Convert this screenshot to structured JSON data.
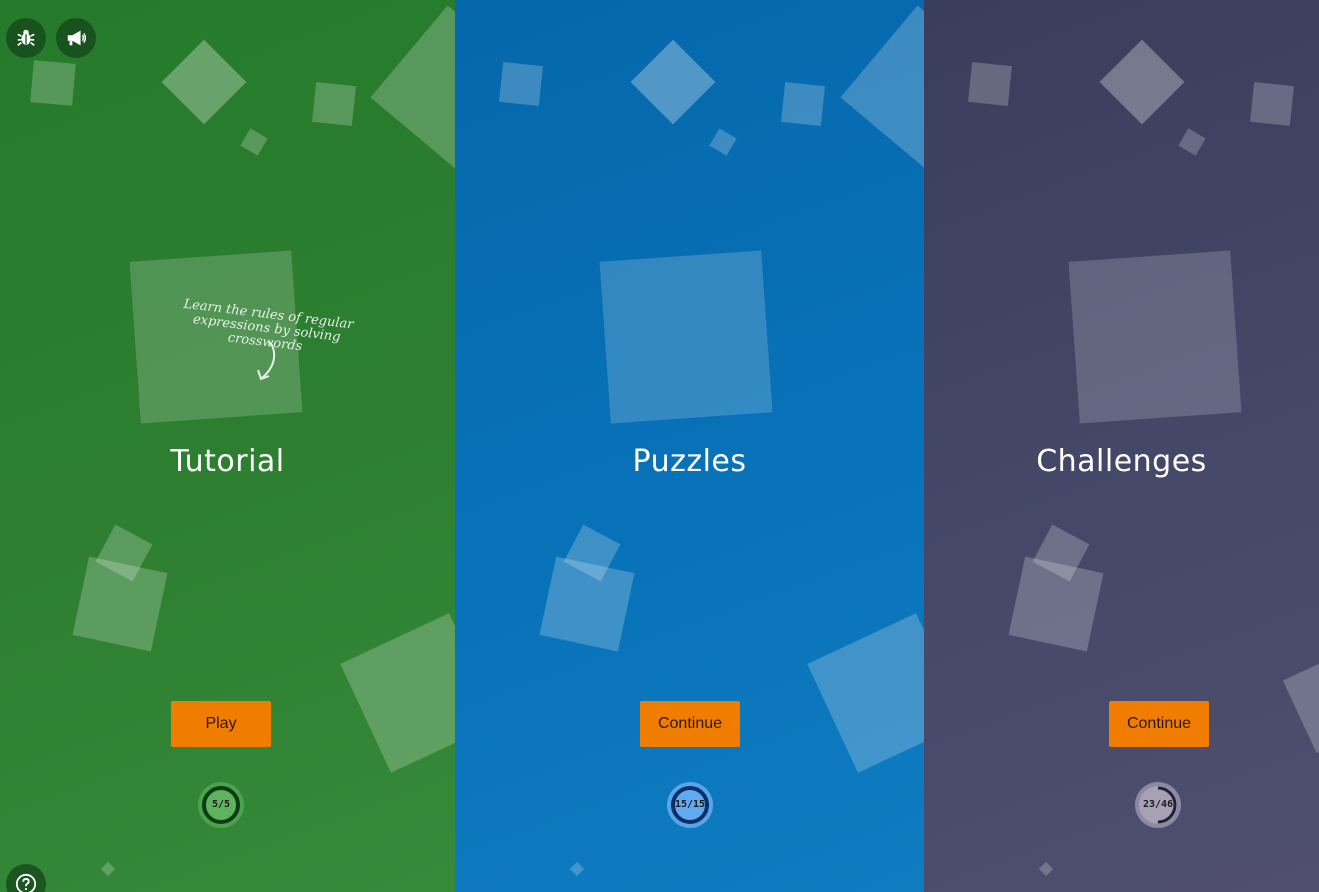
{
  "panels": {
    "tutorial": {
      "title": "Tutorial",
      "button_label": "Play",
      "progress_label": "5/5",
      "progress_fraction": 1.0,
      "hint": "Learn the rules of regular expressions by solving crosswords"
    },
    "puzzles": {
      "title": "Puzzles",
      "button_label": "Continue",
      "progress_label": "15/15",
      "progress_fraction": 1.0
    },
    "challenges": {
      "title": "Challenges",
      "button_label": "Continue",
      "progress_label": "23/46",
      "progress_fraction": 0.5
    }
  },
  "toolbar": {
    "icons": [
      "bug-icon",
      "megaphone-icon",
      "help-icon"
    ]
  },
  "colors": {
    "tutorial_bg": "#2e7f31",
    "puzzles_bg": "#0872b8",
    "challenges_bg": "#454868",
    "button_accent": "#f07c00"
  }
}
